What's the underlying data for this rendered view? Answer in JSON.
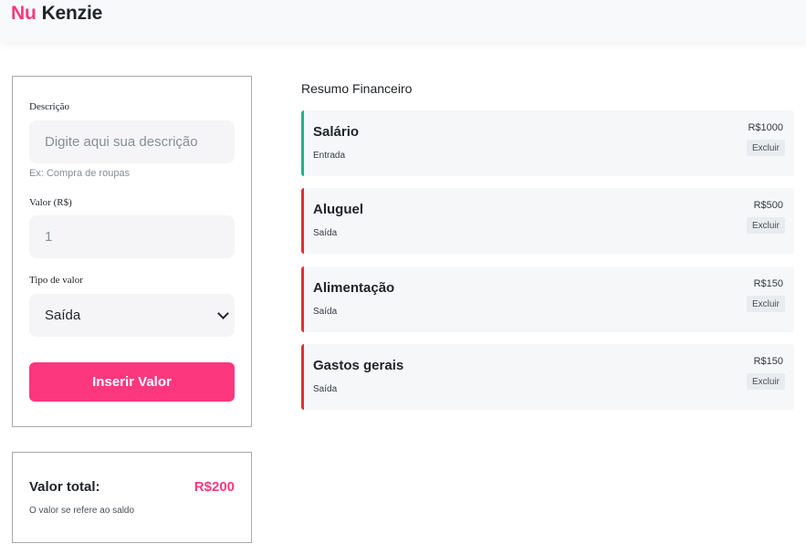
{
  "header": {
    "logo_part1": "Nu",
    "logo_part2": "Kenzie"
  },
  "form": {
    "description_label": "Descrição",
    "description_placeholder": "Digite aqui sua descrição",
    "description_hint": "Ex: Compra de roupas",
    "value_label": "Valor (R$)",
    "value_current": "1",
    "type_label": "Tipo de valor",
    "type_selected": "Saída",
    "submit_label": "Inserir Valor"
  },
  "total": {
    "label": "Valor total:",
    "value": "R$200",
    "note": "O valor se refere ao saldo"
  },
  "summary": {
    "title": "Resumo Financeiro",
    "entries": [
      {
        "title": "Salário",
        "type": "Entrada",
        "amount": "R$1000",
        "delete_label": "Excluir",
        "kind": "income"
      },
      {
        "title": "Aluguel",
        "type": "Saída",
        "amount": "R$500",
        "delete_label": "Excluir",
        "kind": "expense"
      },
      {
        "title": "Alimentação",
        "type": "Saída",
        "amount": "R$150",
        "delete_label": "Excluir",
        "kind": "expense"
      },
      {
        "title": "Gastos gerais",
        "type": "Saída",
        "amount": "R$150",
        "delete_label": "Excluir",
        "kind": "expense"
      }
    ]
  },
  "colors": {
    "brand": "#fd377e",
    "income": "#20b38b",
    "expense": "#e03131"
  }
}
